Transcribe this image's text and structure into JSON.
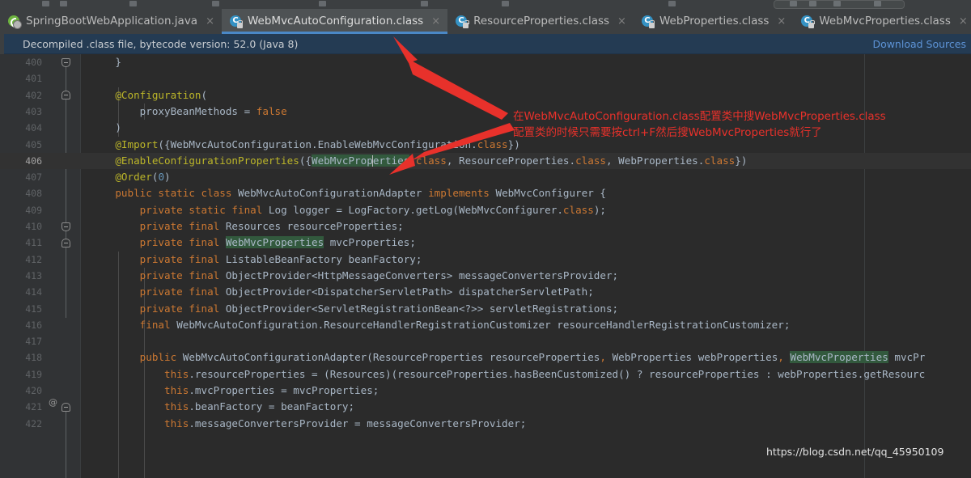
{
  "window": {
    "toolbar_present": true
  },
  "tabs": [
    {
      "label": "SpringBootWebApplication.java",
      "icon": "spring-file-icon",
      "active": false,
      "close_label": "×"
    },
    {
      "label": "WebMvcAutoConfiguration.class",
      "icon": "class-file-icon",
      "active": true,
      "close_label": "×"
    },
    {
      "label": "ResourceProperties.class",
      "icon": "class-file-icon",
      "active": false,
      "close_label": "×"
    },
    {
      "label": "WebProperties.class",
      "icon": "class-file-icon",
      "active": false,
      "close_label": "×"
    },
    {
      "label": "WebMvcProperties.class",
      "icon": "class-file-icon",
      "active": false,
      "close_label": "×"
    }
  ],
  "notification": {
    "message": "Decompiled .class file, bytecode version: 52.0 (Java 8)",
    "action_label": "Download Sources"
  },
  "editor": {
    "first_line_number": 400,
    "current_line_number": 406,
    "highlight_term": "WebMvcProperties",
    "lines": [
      {
        "no": "400",
        "text": "    }"
      },
      {
        "no": "401",
        "text": ""
      },
      {
        "no": "402",
        "text": "    @Configuration("
      },
      {
        "no": "403",
        "text": "        proxyBeanMethods = false"
      },
      {
        "no": "404",
        "text": "    )"
      },
      {
        "no": "405",
        "text": "    @Import({WebMvcAutoConfiguration.EnableWebMvcConfiguration.class})"
      },
      {
        "no": "406",
        "text": "    @EnableConfigurationProperties({WebMvcProperties.class, ResourceProperties.class, WebProperties.class})"
      },
      {
        "no": "407",
        "text": "    @Order(0)"
      },
      {
        "no": "408",
        "text": "    public static class WebMvcAutoConfigurationAdapter implements WebMvcConfigurer {"
      },
      {
        "no": "409",
        "text": "        private static final Log logger = LogFactory.getLog(WebMvcConfigurer.class);"
      },
      {
        "no": "410",
        "text": "        private final Resources resourceProperties;"
      },
      {
        "no": "411",
        "text": "        private final WebMvcProperties mvcProperties;"
      },
      {
        "no": "412",
        "text": "        private final ListableBeanFactory beanFactory;"
      },
      {
        "no": "413",
        "text": "        private final ObjectProvider<HttpMessageConverters> messageConvertersProvider;"
      },
      {
        "no": "414",
        "text": "        private final ObjectProvider<DispatcherServletPath> dispatcherServletPath;"
      },
      {
        "no": "415",
        "text": "        private final ObjectProvider<ServletRegistrationBean<?>> servletRegistrations;"
      },
      {
        "no": "416",
        "text": "        final WebMvcAutoConfiguration.ResourceHandlerRegistrationCustomizer resourceHandlerRegistrationCustomizer;"
      },
      {
        "no": "417",
        "text": ""
      },
      {
        "no": "418",
        "text": "        public WebMvcAutoConfigurationAdapter(ResourceProperties resourceProperties, WebProperties webProperties, WebMvcProperties mvcPr"
      },
      {
        "no": "419",
        "text": "            this.resourceProperties = (Resources)(resourceProperties.hasBeenCustomized() ? resourceProperties : webProperties.getResourc"
      },
      {
        "no": "420",
        "text": "            this.mvcProperties = mvcProperties;"
      },
      {
        "no": "421",
        "text": "            this.beanFactory = beanFactory;"
      },
      {
        "no": "422",
        "text": "            this.messageConvertersProvider = messageConvertersProvider;"
      }
    ],
    "gutter_marker_line": "418",
    "gutter_marker_glyph": "@"
  },
  "annotation": {
    "line1": "在WebMvcAutoConfiguration.class配置类中搜WebMvcProperties.class",
    "line2": "配置类的时候只需要按ctrl+F然后搜WebMvcProperties就行了",
    "color": "#e8312b",
    "arrows": 2
  },
  "watermark": {
    "text": "https://blog.csdn.net/qq_45950109"
  },
  "colors": {
    "editor_bg": "#2b2b2b",
    "gutter_bg": "#313335",
    "tab_active_bg": "#4e5254",
    "tab_underline": "#4a88c7",
    "notification_bg": "#243b53",
    "link": "#5d93d6",
    "keyword": "#cc7832",
    "annotation": "#bbb529",
    "string": "#6a8759",
    "number": "#6897bb",
    "match_highlight": "#32593d",
    "red_marker": "#e8312b"
  }
}
